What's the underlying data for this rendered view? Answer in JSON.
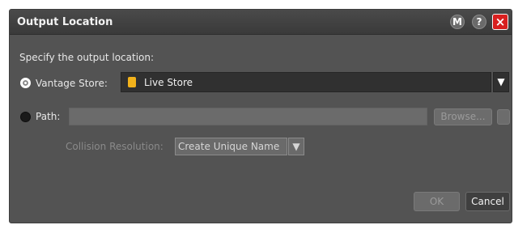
{
  "dialog": {
    "title": "Output Location",
    "buttons": {
      "m": "M",
      "help": "?",
      "close": "×"
    }
  },
  "prompt": "Specify the output location:",
  "vantage_store": {
    "label": "Vantage Store:",
    "selected": "Live Store",
    "selected_state": "checked"
  },
  "path": {
    "label": "Path:",
    "value": "",
    "browse_label": "Browse..."
  },
  "collision": {
    "label": "Collision Resolution:",
    "value": "Create Unique Name"
  },
  "actions": {
    "ok_label": "OK",
    "cancel_label": "Cancel"
  },
  "icons": {
    "store": "store-icon",
    "dropdown": "chevron-down-icon"
  },
  "colors": {
    "dialog_bg": "#535353",
    "close_button": "#d81f1f",
    "store_icon": "#f2b21b"
  }
}
